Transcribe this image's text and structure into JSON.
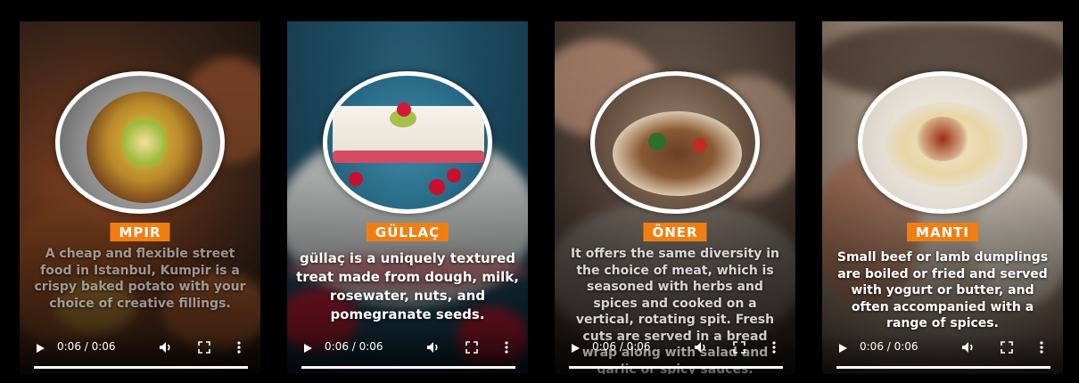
{
  "videos": [
    {
      "title": "MPIR",
      "description": "A cheap and flexible street food in Istanbul, Kumpir is a crispy baked potato with your choice of creative fillings.",
      "time": "0:06 / 0:06",
      "progress": 1.0
    },
    {
      "title": "GÜLLAÇ",
      "description": "güllaç is a uniquely textured treat made from dough, milk, rosewater, nuts, and pomegranate seeds.",
      "time": "0:06 / 0:06",
      "progress": 1.0
    },
    {
      "title": "ÖNER",
      "description": "It offers the same diversity in the choice of meat, which is seasoned with herbs and spices and cooked on a vertical, rotating spit. Fresh cuts are served in a bread wrap along with salad and garlic or spicy sauces.",
      "time": "0:06 / 0:06",
      "progress": 1.0
    },
    {
      "title": "MANTI",
      "description": "Small beef or lamb dumplings are boiled or fried and served with yogurt or butter, and often accompanied with a range of spices.",
      "time": "0:06 / 0:06",
      "progress": 1.0
    }
  ],
  "colors": {
    "tag_background": "#f07f13",
    "page_background": "#000000"
  },
  "icons": [
    "play-icon",
    "volume-icon",
    "fullscreen-icon",
    "more-options-icon"
  ]
}
